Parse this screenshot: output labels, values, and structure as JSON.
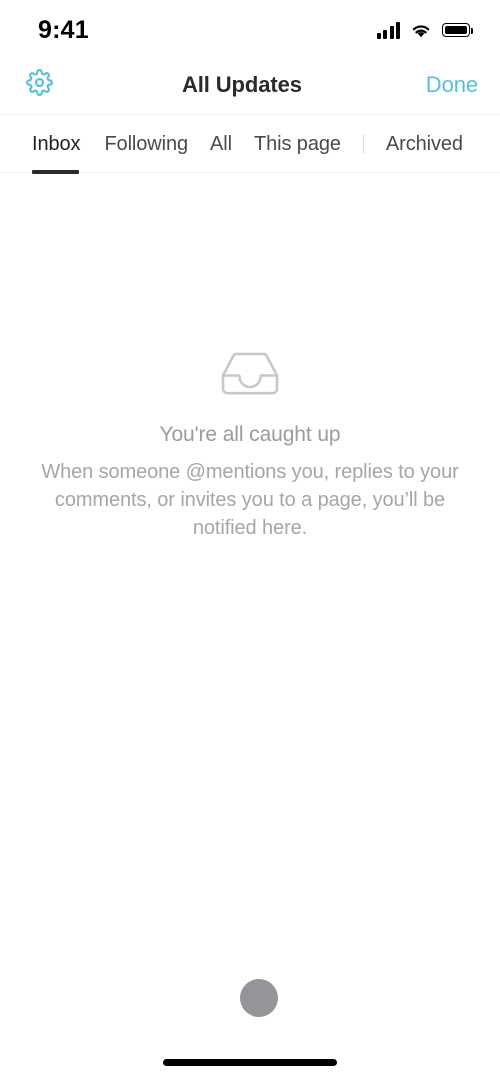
{
  "status_bar": {
    "time": "9:41",
    "signal_icon": "cellular-signal-icon",
    "wifi_icon": "wifi-icon",
    "battery_icon": "battery-full-icon"
  },
  "header": {
    "settings_icon": "gear-icon",
    "title": "All Updates",
    "done_label": "Done",
    "accent_color": "#56c0d8",
    "title_color": "#2b2b2b"
  },
  "tabs": {
    "items": [
      {
        "label": "Inbox",
        "active": true
      },
      {
        "label": "Following",
        "active": false
      },
      {
        "label": "All",
        "active": false
      },
      {
        "label": "This page",
        "active": false
      },
      {
        "label": "Archived",
        "active": false
      }
    ],
    "separator_before": "Archived",
    "active_color": "#222222",
    "inactive_color": "#4a4a4a",
    "underline_color": "#2b2b2b"
  },
  "empty_state": {
    "icon": "inbox-tray-icon",
    "icon_color": "#c7c7cc",
    "title": "You're all caught up",
    "body": "When someone @mentions you, replies to your comments, or invites you to a page, you’ll be notified here.",
    "title_color": "#9a9aa0",
    "body_color": "#a5a5ab"
  },
  "bottom": {
    "cursor_dot": "touch-indicator-dot",
    "cursor_color": "#949499",
    "home_indicator": "home-indicator-bar"
  }
}
